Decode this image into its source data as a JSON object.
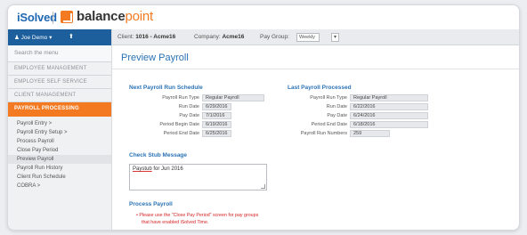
{
  "brand": {
    "isolved": "iSolved",
    "bp_main": "balance",
    "bp_accent": "point"
  },
  "sidebar": {
    "user": "Joe Demo",
    "user_caret": "▾",
    "pin": "⬆",
    "search_placeholder": "Search the menu",
    "sections": [
      "EMPLOYEE MANAGEMENT",
      "EMPLOYEE SELF SERVICE",
      "CLIENT MANAGEMENT"
    ],
    "active_section": "PAYROLL PROCESSING",
    "sub_items": [
      "Payroll Entry >",
      "Payroll Entry Setup >",
      "Process Payroll",
      "Close Pay Period",
      "Preview Payroll",
      "Payroll Run History",
      "Client Run Schedule",
      "COBRA >"
    ]
  },
  "topbar": {
    "client_label": "Client:",
    "client_value": "1016 - Acme16",
    "company_label": "Company:",
    "company_value": "Acme16",
    "paygroup_label": "Pay Group:",
    "paygroup_value": "Weekly",
    "arrow": "▾"
  },
  "main": {
    "title": "Preview Payroll",
    "next_run": {
      "heading": "Next Payroll Run Schedule",
      "rows": [
        {
          "label": "Payroll Run Type",
          "value": "Regular Payroll"
        },
        {
          "label": "Run Date",
          "value": "6/29/2016"
        },
        {
          "label": "Pay Date",
          "value": "7/1/2016"
        },
        {
          "label": "Period Begin Date",
          "value": "6/19/2016"
        },
        {
          "label": "Period End Date",
          "value": "6/25/2016"
        }
      ]
    },
    "last_run": {
      "heading": "Last Payroll Processed",
      "rows": [
        {
          "label": "Payroll Run Type",
          "value": "Regular Payroll"
        },
        {
          "label": "Run Date",
          "value": "6/22/2016"
        },
        {
          "label": "Pay Date",
          "value": "6/24/2016"
        },
        {
          "label": "Period End Date",
          "value": "6/18/2016"
        },
        {
          "label": "Payroll Run Numbers",
          "value": "259"
        }
      ]
    },
    "check_stub": {
      "heading": "Check Stub Message",
      "text_word": "Paystub",
      "text_rest": " for Jun 2016"
    },
    "process": {
      "heading": "Process Payroll",
      "warning_line1": "• Please use the \"Close Pay Period\" screen for pay groups",
      "warning_line2": "that have enabled iSolved Time."
    }
  }
}
